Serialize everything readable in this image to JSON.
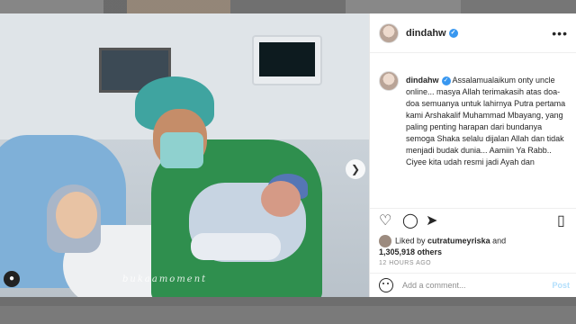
{
  "post": {
    "username": "dindahw",
    "caption_text": "Assalamualaikum onty uncle online... masya Allah terimakasih atas doa-doa semuanya untuk lahirnya Putra pertama kami Arshakalif Muhammad Mbayang, yang paling penting harapan dari bundanya semoga Shaka selalu dijalan Allah dan tidak menjadi budak dunia... Aamiin Ya Rabb.. Ciyee kita udah resmi jadi Ayah dan",
    "liked_by_prefix": "Liked by",
    "liked_by_user": "cutratumeyriska",
    "liked_by_and": "and",
    "others_count": "1,305,918 others",
    "timestamp": "12 HOURS AGO",
    "comment_placeholder": "Add a comment...",
    "post_button": "Post",
    "watermark": "bukaamoment"
  },
  "icons": {
    "more": "more-options-icon",
    "like": "heart-icon",
    "comment": "comment-icon",
    "share": "share-icon",
    "save": "bookmark-icon",
    "emoji": "emoji-icon",
    "next": "chevron-right-icon",
    "tag": "user-tag-icon"
  },
  "colors": {
    "verified": "#3897f0",
    "post_button": "#b2dffc"
  }
}
